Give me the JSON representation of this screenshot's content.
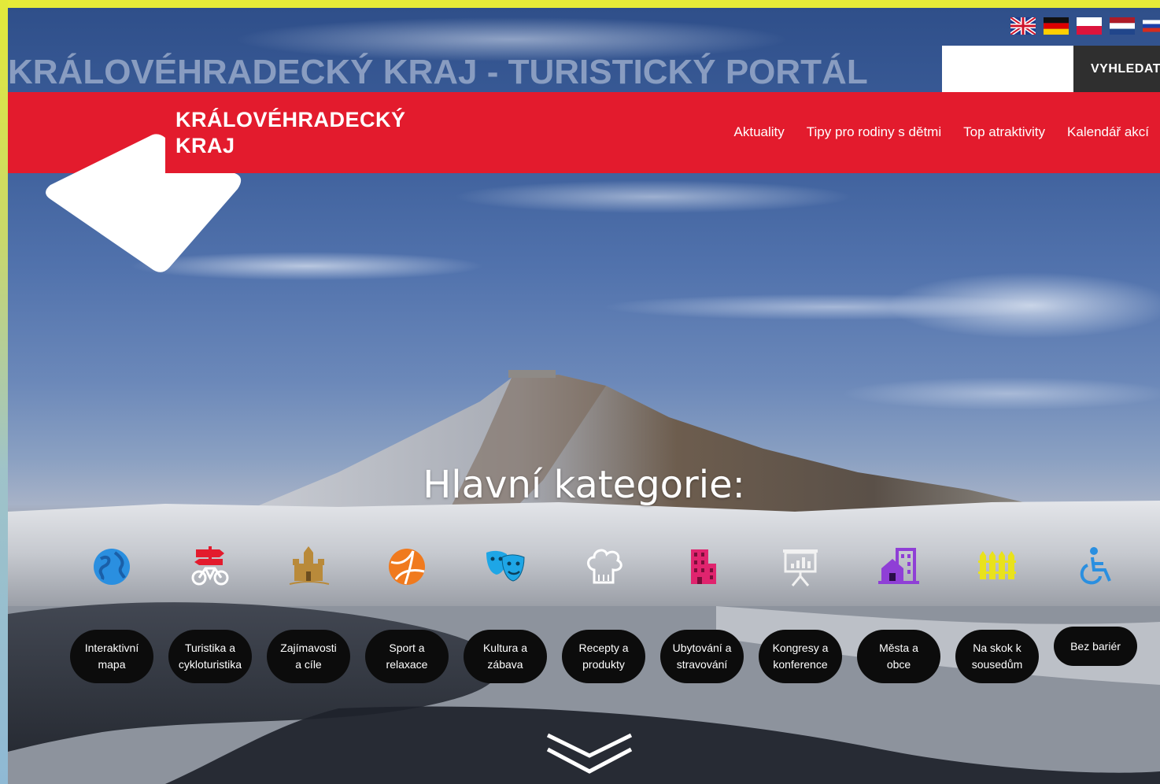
{
  "header": {
    "portal_title": "KRÁLOVÉHRADECKÝ KRAJ - TURISTICKÝ PORTÁL",
    "search": {
      "value": "",
      "placeholder": "",
      "button_label": "VYHLEDAT"
    },
    "languages": [
      "flag-uk",
      "flag-de",
      "flag-pl",
      "flag-nl",
      "flag-ru"
    ]
  },
  "brand": {
    "line1": "KRÁLOVÉHRADECKÝ",
    "line2": "KRAJ"
  },
  "nav": {
    "items": [
      "Aktuality",
      "Tipy pro rodiny s dětmi",
      "Top atraktivity",
      "Kalendář akcí"
    ]
  },
  "main": {
    "heading": "Hlavní kategorie:",
    "categories": [
      {
        "line1": "Interaktivní",
        "line2": "mapa",
        "icon": "globe-icon",
        "color": "#2a8fe0"
      },
      {
        "line1": "Turistika a",
        "line2": "cykloturistika",
        "icon": "bicycle-signpost-icon",
        "color": "#e31b2d"
      },
      {
        "line1": "Zajímavosti",
        "line2": "a cíle",
        "icon": "castle-icon",
        "color": "#b98a3a"
      },
      {
        "line1": "Sport a",
        "line2": "relaxace",
        "icon": "ball-icon",
        "color": "#f07a1e"
      },
      {
        "line1": "Kultura a",
        "line2": "zábava",
        "icon": "theater-masks-icon",
        "color": "#1ea6e6"
      },
      {
        "line1": "Recepty a",
        "line2": "produkty",
        "icon": "chef-hat-icon",
        "color": "#ffffff"
      },
      {
        "line1": "Ubytování a",
        "line2": "stravování",
        "icon": "hotel-icon",
        "color": "#e0246e"
      },
      {
        "line1": "Kongresy a",
        "line2": "konference",
        "icon": "presentation-board-icon",
        "color": "#f2f2f2"
      },
      {
        "line1": "Města a",
        "line2": "obce",
        "icon": "town-icon",
        "color": "#8f3fd6"
      },
      {
        "line1": "Na skok k",
        "line2": "sousedům",
        "icon": "fence-icon",
        "color": "#e9e21c"
      },
      {
        "line1": "Bez bariér",
        "line2": "",
        "icon": "wheelchair-icon",
        "color": "#2a8fe0"
      }
    ]
  }
}
